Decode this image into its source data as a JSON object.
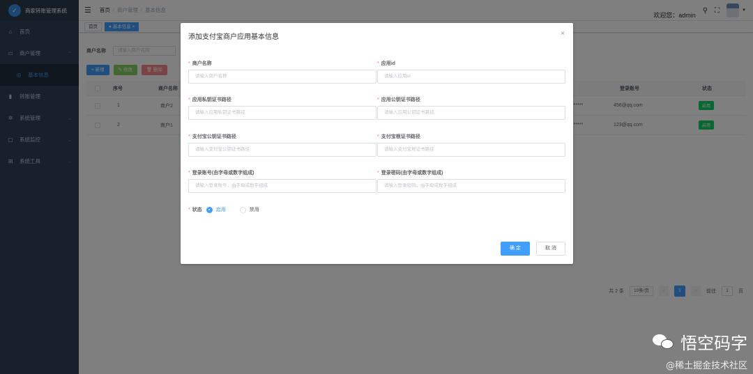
{
  "sidebar": {
    "logo_text": "商家转账管理系统",
    "items": [
      {
        "label": "首页",
        "icon": "home-icon",
        "glyph": "⌂"
      },
      {
        "label": "商户管理",
        "icon": "store-icon",
        "glyph": "▭",
        "expanded": true
      },
      {
        "label": "基本信息",
        "icon": "info-icon",
        "glyph": "◎",
        "sub": true,
        "active": true
      },
      {
        "label": "转账管理",
        "icon": "transfer-icon",
        "glyph": "▮"
      },
      {
        "label": "系统管理",
        "icon": "gear-icon",
        "glyph": "✲"
      },
      {
        "label": "系统监控",
        "icon": "monitor-icon",
        "glyph": "▢"
      },
      {
        "label": "系统工具",
        "icon": "tools-icon",
        "glyph": "⊞"
      }
    ]
  },
  "navbar": {
    "breadcrumb": [
      "首页",
      "商户管理",
      "基本信息"
    ],
    "welcome": "欢迎您：admin"
  },
  "tags": [
    {
      "label": "首页",
      "active": false
    },
    {
      "label": "● 基本信息 ×",
      "active": true
    }
  ],
  "main": {
    "search_label": "商户名称",
    "search_placeholder": "请输入商户名称",
    "toolbar": {
      "add": "+ 新增",
      "edit": "✎ 修改",
      "delete": "🗑 删除"
    },
    "table": {
      "headers": {
        "index": "序号",
        "merchant": "商户名称",
        "account": "登录账号",
        "status": "状态"
      },
      "rows": [
        {
          "index": "1",
          "merchant": "商户2",
          "masked": "******",
          "account": "456@qq.com",
          "status": "启用"
        },
        {
          "index": "2",
          "merchant": "商户1",
          "masked": "******",
          "account": "123@qq.com",
          "status": "启用"
        }
      ]
    },
    "pagination": {
      "total": "共 2 条",
      "page_size": "10条/页",
      "current": "1",
      "goto_label": "前往",
      "goto_value": "1",
      "page_suffix": "页"
    }
  },
  "dialog": {
    "title": "添加支付宝商户应用基本信息",
    "fields": {
      "merchant_name": {
        "label": "商户名称",
        "placeholder": "请输入商户名称"
      },
      "app_id": {
        "label": "应用id",
        "placeholder": "请输入应用id"
      },
      "app_private_key": {
        "label": "应用私钥证书路径",
        "placeholder": "请输入应用私钥证书路径"
      },
      "app_public_key": {
        "label": "应用公钥证书路径",
        "placeholder": "请输入应用公钥证书路径"
      },
      "alipay_public_key": {
        "label": "支付宝公钥证书路径",
        "placeholder": "请输入支付宝公钥证书路径"
      },
      "alipay_root_cert": {
        "label": "支付宝根证书路径",
        "placeholder": "请输入支付宝根证书路径"
      },
      "login_account": {
        "label": "登录账号(由字母或数字组成)",
        "placeholder": "请输入登录账号，由字母或数字组成"
      },
      "login_password": {
        "label": "登录密码(由字母或数字组成)",
        "placeholder": "请输入登录密码，由字母或数字组成"
      }
    },
    "status": {
      "label": "状态",
      "enabled": "启用",
      "disabled": "禁用",
      "selected": "启用"
    },
    "confirm": "确 定",
    "cancel": "取 消"
  },
  "watermark": {
    "name": "悟空码字",
    "sub": "@稀土掘金技术社区"
  },
  "colors": {
    "primary": "#409eff",
    "sidebar": "#304156",
    "success": "#13ce66",
    "required": "#f56c6c"
  }
}
